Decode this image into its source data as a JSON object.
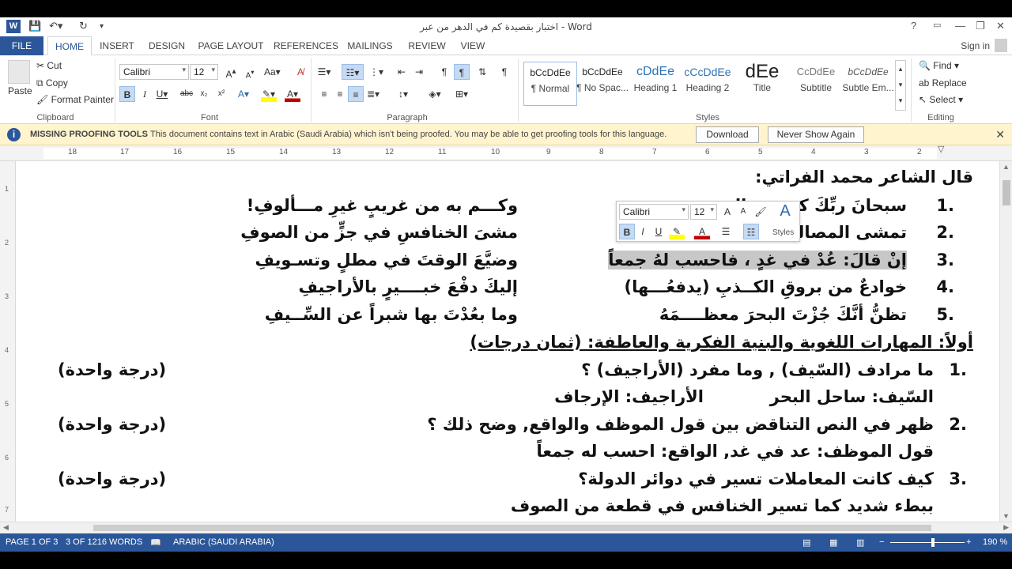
{
  "window": {
    "title": "اختبار بقصيدة كم في الدهر من عبر - Word",
    "help": "?",
    "controls": [
      "—",
      "❐",
      "✕"
    ]
  },
  "tabs": [
    "FILE",
    "HOME",
    "INSERT",
    "DESIGN",
    "PAGE LAYOUT",
    "REFERENCES",
    "MAILINGS",
    "REVIEW",
    "VIEW"
  ],
  "active_tab": "HOME",
  "signin": "Sign in",
  "ribbon": {
    "clipboard": {
      "paste": "Paste",
      "cut": "Cut",
      "copy": "Copy",
      "format_painter": "Format Painter",
      "label": "Clipboard"
    },
    "font": {
      "name": "Calibri",
      "size": "12",
      "label": "Font"
    },
    "paragraph": {
      "label": "Paragraph"
    },
    "styles": {
      "label": "Styles",
      "items": [
        {
          "sample": "bCcDdEe",
          "name": "¶ Normal"
        },
        {
          "sample": "bCcDdEe",
          "name": "¶ No Spac..."
        },
        {
          "sample": "cDdEe",
          "name": "Heading 1"
        },
        {
          "sample": "cCcDdEe",
          "name": "Heading 2"
        },
        {
          "sample": "dEe",
          "name": "Title"
        },
        {
          "sample": "CcDdEe",
          "name": "Subtitle"
        },
        {
          "sample": "bCcDdEe",
          "name": "Subtle Em..."
        }
      ]
    },
    "editing": {
      "find": "Find",
      "replace": "Replace",
      "select": "Select",
      "label": "Editing"
    }
  },
  "message_bar": {
    "title": "MISSING PROOFING TOOLS",
    "text": "This document contains text in Arabic (Saudi Arabia) which isn't being proofed. You may be able to get proofing tools for this language.",
    "download": "Download",
    "never_show": "Never Show Again"
  },
  "ruler_numbers": [
    "18",
    "17",
    "16",
    "15",
    "14",
    "13",
    "12",
    "11",
    "10",
    "9",
    "8",
    "7",
    "6",
    "5",
    "4",
    "3",
    "2",
    "1"
  ],
  "vruler_numbers": [
    "1",
    "2",
    "3",
    "4",
    "5",
    "6",
    "7"
  ],
  "mini_toolbar": {
    "font": "Calibri",
    "size": "12",
    "styles": "Styles"
  },
  "document": {
    "heading": "قال الشاعر محمد الفراتي:",
    "poem": [
      {
        "num": ".1",
        "right": "سبحانَ ربِّكَ كم في الدهرِ من عبرٍ",
        "left": "وكـــم به من غريبٍ غيرِ مـــألوفِ!"
      },
      {
        "num": ".2",
        "right": "تمشى المصالحُ في أيامِنا",
        "left": "مشىَ الخنافسِ في جزٍّ من الصوفِ"
      },
      {
        "num": ".3",
        "right": "إنْ قالَ: عُدْ في غدٍ ، فاحسب لهُ جمعاً",
        "left": "وضيَّعَ الوقتَ في مطلٍ وتسـويفِ"
      },
      {
        "num": ".4",
        "right": "خوادعٌ من بروقِ الكــذبِ (يدفعُـــها)",
        "left": "إليكَ دفْعَ خبــــيرٍ بالأراجيفِ"
      },
      {
        "num": ".5",
        "right": "تظنُّ أنَّكَ جُزْتَ البحرَ معظــــمَهُ",
        "left": "وما بعُدْتَ بها شبراً عن السِّــيفِ"
      }
    ],
    "section_title": "أولاً: المهارات اللغوية والبنية الفكرية والعاطفة: (ثمان درجات)",
    "questions": [
      {
        "num": ".1",
        "q": "ما مرادف (السّيف) , وما مفرد (الأراجيف) ؟",
        "grade": "(درجة واحدة)",
        "a": "السّيف: ساحل البحر",
        "a2": "الأراجيف: الإرجاف"
      },
      {
        "num": ".2",
        "q": "ظهر في النص التناقض بين قول الموظف والواقع, وضح ذلك ؟",
        "grade": "(درجة واحدة)",
        "a": "قول الموظف: عد في غد, الواقع: احسب له جمعاً"
      },
      {
        "num": ".3",
        "q": "كيف كانت المعاملات تسير في دوائر الدولة؟",
        "grade": "(درجة واحدة)",
        "a": "ببطء شديد كما تسير الخنافس في قطعة من الصوف"
      }
    ]
  },
  "status_bar": {
    "page": "PAGE 1 OF 3",
    "words": "3 OF 1216 WORDS",
    "language": "ARABIC (SAUDI ARABIA)",
    "zoom": "190 %"
  }
}
